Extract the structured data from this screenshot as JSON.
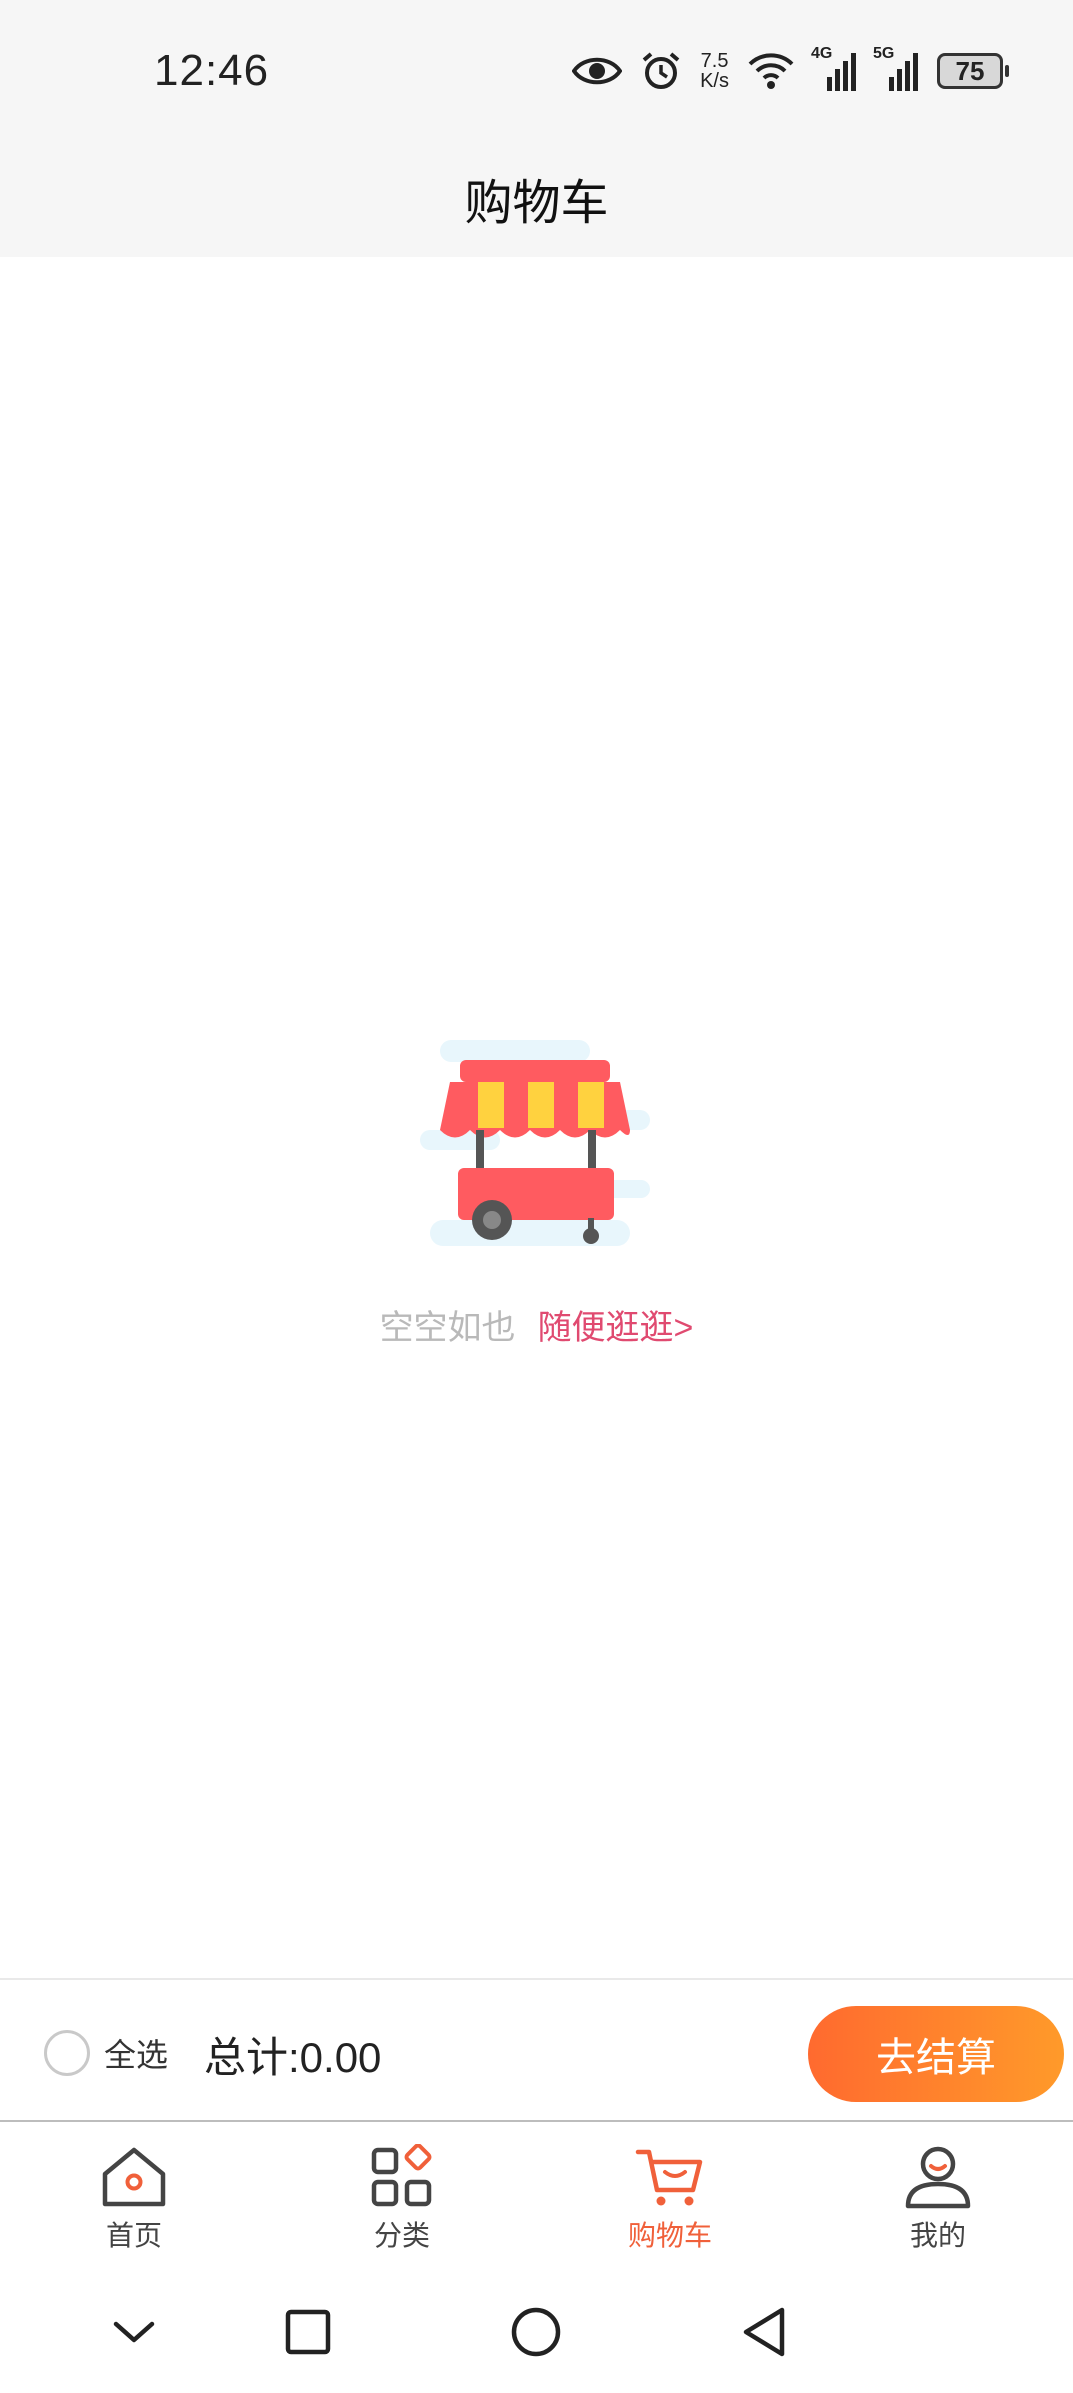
{
  "status_bar": {
    "time": "12:46",
    "net_speed_value": "7.5",
    "net_speed_unit": "K/s",
    "signal1_label": "4G",
    "signal2_label": "5G",
    "battery": "75"
  },
  "header": {
    "title": "购物车"
  },
  "empty_state": {
    "message": "空空如也",
    "link": "随便逛逛>"
  },
  "checkout": {
    "select_all": "全选",
    "total": "总计:0.00",
    "button": "去结算"
  },
  "tabs": [
    {
      "label": "首页",
      "icon": "home-icon"
    },
    {
      "label": "分类",
      "icon": "category-icon"
    },
    {
      "label": "购物车",
      "icon": "cart-icon",
      "active": true
    },
    {
      "label": "我的",
      "icon": "user-icon"
    }
  ],
  "colors": {
    "accent": "#f0603a",
    "link": "#e04a70",
    "button_start": "#ff6a2f",
    "button_end": "#ff9a2a"
  }
}
